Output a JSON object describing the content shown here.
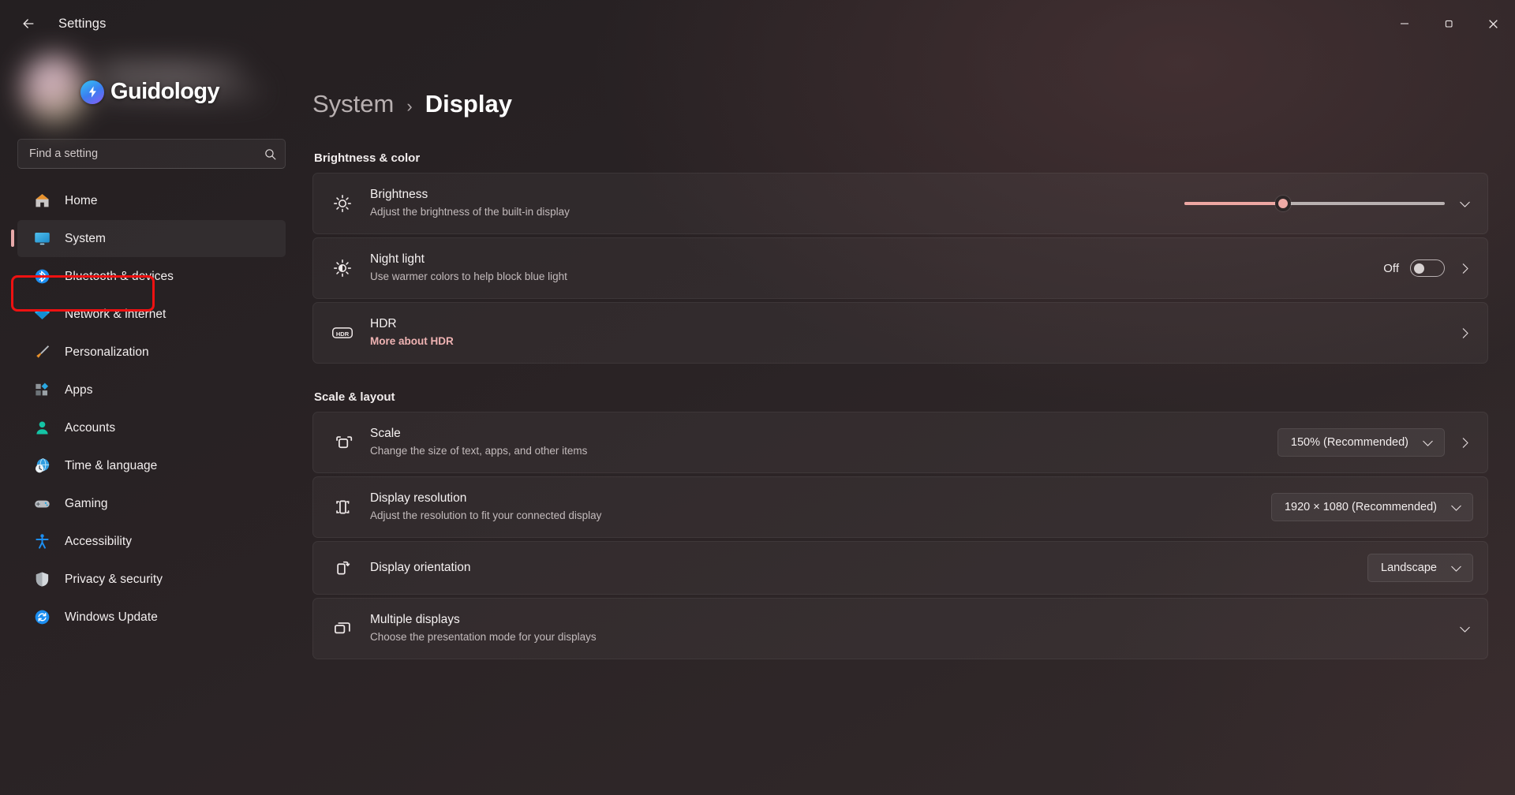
{
  "window": {
    "title": "Settings",
    "back_icon": "back-arrow-icon",
    "minimize_icon": "minimize-icon",
    "maximize_icon": "maximize-restore-icon",
    "close_icon": "close-icon"
  },
  "watermark": {
    "text": "Guidology",
    "logo_icon": "guidology-bolt-logo-icon"
  },
  "search": {
    "placeholder": "Find a setting",
    "value": "",
    "icon": "search-icon"
  },
  "sidebar": {
    "items": [
      {
        "label": "Home",
        "icon": "home-icon",
        "selected": false
      },
      {
        "label": "System",
        "icon": "system-monitor-icon",
        "selected": true
      },
      {
        "label": "Bluetooth & devices",
        "icon": "bluetooth-icon",
        "selected": false
      },
      {
        "label": "Network & internet",
        "icon": "wifi-icon",
        "selected": false
      },
      {
        "label": "Personalization",
        "icon": "paintbrush-icon",
        "selected": false
      },
      {
        "label": "Apps",
        "icon": "apps-grid-icon",
        "selected": false
      },
      {
        "label": "Accounts",
        "icon": "person-icon",
        "selected": false
      },
      {
        "label": "Time & language",
        "icon": "globe-clock-icon",
        "selected": false
      },
      {
        "label": "Gaming",
        "icon": "gamepad-icon",
        "selected": false
      },
      {
        "label": "Accessibility",
        "icon": "accessibility-person-icon",
        "selected": false
      },
      {
        "label": "Privacy & security",
        "icon": "shield-icon",
        "selected": false
      },
      {
        "label": "Windows Update",
        "icon": "update-refresh-icon",
        "selected": false
      }
    ],
    "accent_color": "#e8a9a9",
    "annotation_color": "#ee1111"
  },
  "breadcrumb": {
    "parent": "System",
    "separator": "›",
    "current": "Display"
  },
  "sections": [
    {
      "heading": "Brightness & color",
      "rows": [
        {
          "title": "Brightness",
          "subtitle": "Adjust the brightness of the built-in display",
          "icon": "brightness-sun-icon",
          "control": "slider",
          "slider_percent": 38,
          "expand_icon": "chevron-down-icon"
        },
        {
          "title": "Night light",
          "subtitle": "Use warmer colors to help block blue light",
          "icon": "night-light-icon",
          "control": "toggle",
          "toggle_state": "Off",
          "nav_icon": "chevron-right-icon"
        },
        {
          "title": "HDR",
          "subtitle": "More about HDR",
          "subtitle_is_link": true,
          "icon": "hdr-badge-icon",
          "control": "none",
          "nav_icon": "chevron-right-icon"
        }
      ]
    },
    {
      "heading": "Scale & layout",
      "rows": [
        {
          "title": "Scale",
          "subtitle": "Change the size of text, apps, and other items",
          "icon": "scale-resize-icon",
          "control": "combo",
          "combo_value": "150% (Recommended)",
          "combo_icon": "chevron-down-icon",
          "nav_icon": "chevron-right-icon"
        },
        {
          "title": "Display resolution",
          "subtitle": "Adjust the resolution to fit your connected display",
          "icon": "display-resolution-icon",
          "control": "combo",
          "combo_value": "1920 × 1080 (Recommended)",
          "combo_icon": "chevron-down-icon"
        },
        {
          "title": "Display orientation",
          "subtitle": "",
          "icon": "display-rotate-icon",
          "control": "combo",
          "combo_value": "Landscape",
          "combo_icon": "chevron-down-icon"
        },
        {
          "title": "Multiple displays",
          "subtitle": "Choose the presentation mode for your displays",
          "icon": "multiple-displays-icon",
          "control": "expand",
          "expand_icon": "chevron-down-icon"
        }
      ]
    }
  ]
}
